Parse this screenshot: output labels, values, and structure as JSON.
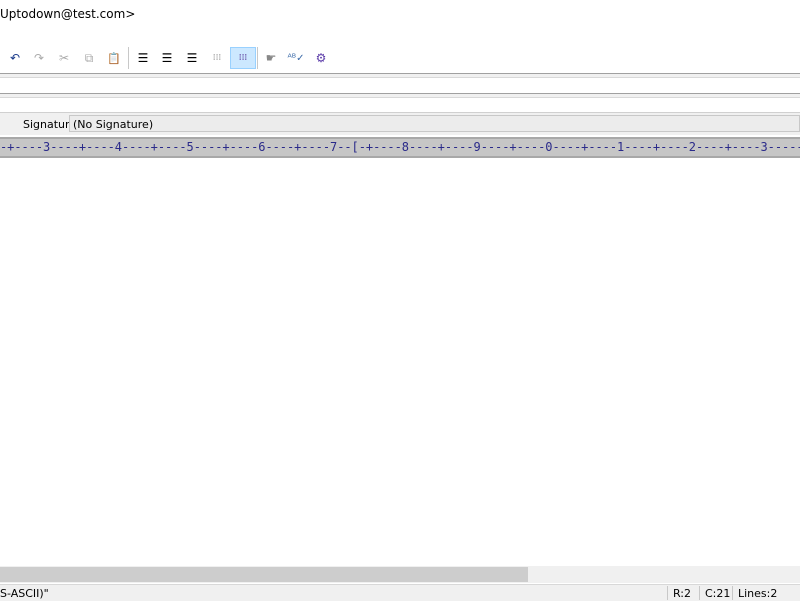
{
  "header": {
    "to_line": "Uptodown@test.com>"
  },
  "toolbar": {
    "buttons": [
      {
        "name": "undo",
        "glyph": "↶"
      },
      {
        "name": "redo",
        "glyph": "↷"
      },
      {
        "name": "cut",
        "glyph": "✂"
      },
      {
        "name": "copy",
        "glyph": "⧉"
      },
      {
        "name": "paste",
        "glyph": "📋"
      },
      {
        "name": "align-center",
        "glyph": "☰"
      },
      {
        "name": "align-left",
        "glyph": "☰"
      },
      {
        "name": "align-right",
        "glyph": "☰"
      },
      {
        "name": "columns",
        "glyph": "⁞⁞⁞"
      },
      {
        "name": "wrap",
        "glyph": "⁞⁞⁞"
      },
      {
        "name": "point",
        "glyph": "☛"
      },
      {
        "name": "spell-check",
        "glyph": "ᴬᴮ✓"
      },
      {
        "name": "tools",
        "glyph": "⚙"
      }
    ],
    "active": "wrap"
  },
  "signature": {
    "label": "Signature:",
    "value": "(No Signature)"
  },
  "ruler": {
    "text": "-+----3----+----4----+----5----+----6----+----7--[-+----8----+----9----+----0----+----1----+----2----+----3-----"
  },
  "status": {
    "encoding": "S-ASCII)\"",
    "row": "R:2",
    "col": "C:21",
    "lines": "Lines:2"
  }
}
